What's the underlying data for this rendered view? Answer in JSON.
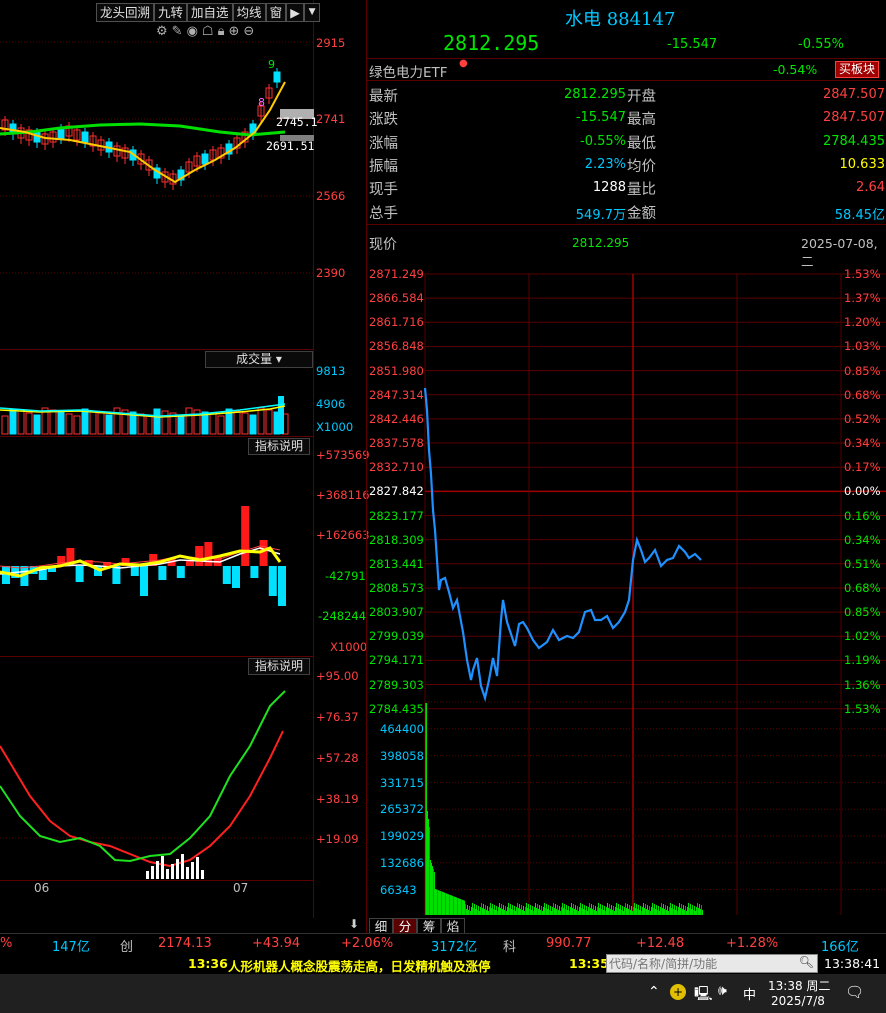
{
  "left_toolbar": [
    "龙头回溯",
    "九转",
    "加自选",
    "均线",
    "窗"
  ],
  "kline": {
    "price_axis": [
      "2915",
      "2741",
      "2566",
      "2390"
    ],
    "last_labels": [
      "2745.1",
      "2691.51"
    ],
    "nine_turn_numbers": [
      "9",
      "8"
    ],
    "month_labels": [
      "06",
      "07"
    ]
  },
  "volume_panel": {
    "label": "成交量",
    "axis": [
      "9813",
      "4906",
      "X1000"
    ]
  },
  "indicator_panel1": {
    "label": "指标说明",
    "axis": [
      "+573569",
      "+368116",
      "+162663",
      "-42791",
      "-248244",
      "X1000"
    ]
  },
  "indicator_panel2": {
    "label": "指标说明",
    "axis": [
      "+95.00",
      "+76.37",
      "+57.28",
      "+38.19",
      "+19.09"
    ]
  },
  "quote": {
    "title": "水电",
    "code": "884147",
    "price": "2812.295",
    "change": "-15.547",
    "change_pct": "-0.55%",
    "etf_name": "绿色电力ETF",
    "etf_pct": "-0.54%",
    "buy_button": "买板块",
    "rows": [
      {
        "l1": "最新",
        "v1": "2812.295",
        "l2": "开盘",
        "v2": "2847.507"
      },
      {
        "l1": "涨跌",
        "v1": "-15.547",
        "l2": "最高",
        "v2": "2847.507"
      },
      {
        "l1": "涨幅",
        "v1": "-0.55%",
        "l2": "最低",
        "v2": "2784.435"
      },
      {
        "l1": "振幅",
        "v1": "2.23%",
        "l2": "均价",
        "v2": "10.633"
      },
      {
        "l1": "现手",
        "v1": "1288",
        "l2": "量比",
        "v2": "2.64"
      },
      {
        "l1": "总手",
        "v1": "549.7万",
        "l2": "金额",
        "v2": "58.45亿"
      }
    ]
  },
  "intraday": {
    "label": "现价",
    "price": "2812.295",
    "date": "2025-07-08,二",
    "price_axis": [
      "2871.249",
      "2866.584",
      "2861.716",
      "2856.848",
      "2851.980",
      "2847.314",
      "2842.446",
      "2837.578",
      "2832.710",
      "2827.842",
      "2823.177",
      "2818.309",
      "2813.441",
      "2808.573",
      "2803.907",
      "2799.039",
      "2794.171",
      "2789.303",
      "2784.435"
    ],
    "pct_axis": [
      "1.53%",
      "1.37%",
      "1.20%",
      "1.03%",
      "0.85%",
      "0.68%",
      "0.52%",
      "0.34%",
      "0.17%",
      "0.00%",
      "0.16%",
      "0.34%",
      "0.51%",
      "0.68%",
      "0.85%",
      "1.02%",
      "1.19%",
      "1.36%",
      "1.53%"
    ],
    "volume_axis": [
      "464400",
      "398058",
      "331715",
      "265372",
      "199029",
      "132686",
      "66343"
    ]
  },
  "bottom_tabs": [
    "细",
    "分",
    "筹",
    "焰"
  ],
  "index_bar": {
    "left_pct": "%",
    "left_amount": "147亿",
    "chuang_label": "创",
    "chuang_value": "2174.13",
    "chuang_change": "+43.94",
    "chuang_pct": "+2.06%",
    "chuang_amount": "3172亿",
    "ke_label": "科",
    "ke_value": "990.77",
    "ke_change": "+12.48",
    "ke_pct": "+1.28%",
    "ke_amount": "166亿"
  },
  "news": {
    "time": "13:36",
    "headline": "人形机器人概念股震荡走高，日发精机触及涨停",
    "time2": "13:35",
    "search_placeholder": "代码/名称/简拼/功能",
    "clock": "13:38:41"
  },
  "taskbar": {
    "ime": "中",
    "time": "13:38 周二",
    "date": "2025/7/8"
  }
}
